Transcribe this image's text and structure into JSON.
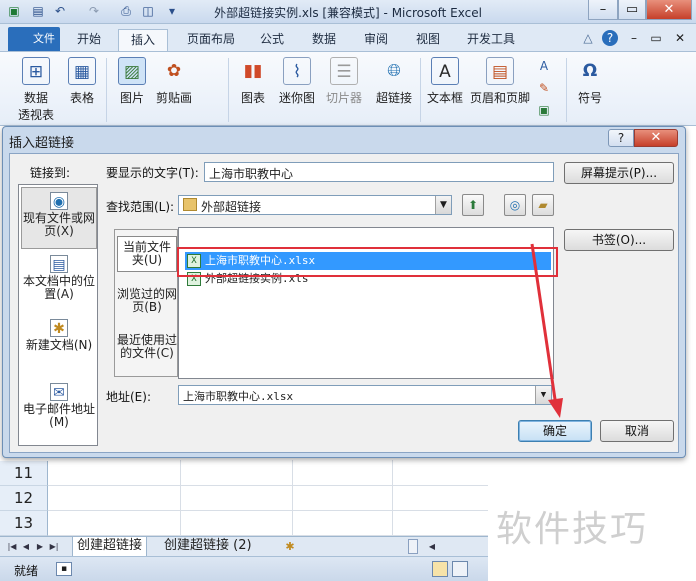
{
  "window": {
    "title": "外部超链接实例.xls  [兼容模式]  -  Microsoft Excel",
    "min_icon": "minimize-icon",
    "max_icon": "restore-icon",
    "close_icon": "close-icon"
  },
  "ribbon": {
    "tabs": [
      {
        "label": "文件"
      },
      {
        "label": "开始"
      },
      {
        "label": "插入"
      },
      {
        "label": "页面布局"
      },
      {
        "label": "公式"
      },
      {
        "label": "数据"
      },
      {
        "label": "审阅"
      },
      {
        "label": "视图"
      },
      {
        "label": "开发工具"
      }
    ],
    "active_tab": "插入",
    "buttons": [
      {
        "label": "数据",
        "sub": "透视表",
        "icon": "pivot-table-icon"
      },
      {
        "label": "表格",
        "icon": "table-icon"
      },
      {
        "label": "图片",
        "icon": "picture-icon"
      },
      {
        "label": "剪贴画",
        "icon": "clipart-icon"
      },
      {
        "label": "图表",
        "icon": "chart-icon"
      },
      {
        "label": "迷你图",
        "icon": "sparkline-icon"
      },
      {
        "label": "切片器",
        "icon": "slicer-icon"
      },
      {
        "label": "超链接",
        "icon": "hyperlink-globe-icon"
      },
      {
        "label": "文本框",
        "icon": "textbox-icon"
      },
      {
        "label": "页眉和页脚",
        "icon": "header-footer-icon"
      },
      {
        "label": "符号",
        "icon": "omega-symbol-icon"
      }
    ]
  },
  "sheet": {
    "rows": [
      "11",
      "12",
      "13"
    ],
    "tabs": [
      {
        "label": "创建超链接"
      },
      {
        "label": "创建超链接 (2)"
      }
    ],
    "status": "就绪"
  },
  "dialog": {
    "title": "插入超链接",
    "help": "?",
    "close": "✕",
    "link_to_label": "链接到:",
    "link_options": [
      {
        "label": "现有文件或网页(X)",
        "icon": "existing-file-globe-icon"
      },
      {
        "label": "本文档中的位置(A)",
        "icon": "place-in-document-icon"
      },
      {
        "label": "新建文档(N)",
        "icon": "new-document-icon"
      },
      {
        "label": "电子邮件地址(M)",
        "icon": "email-address-icon"
      }
    ],
    "display_text_label": "要显示的文字(T):",
    "display_text_value": "上海市职教中心",
    "screentip_button": "屏幕提示(P)...",
    "look_in_label": "查找范围(L):",
    "look_in_value": "外部超链接",
    "sub_tabs": [
      {
        "label": "当前文件夹(U)"
      },
      {
        "label": "浏览过的网页(B)"
      },
      {
        "label": "最近使用过的文件(C)"
      }
    ],
    "files": [
      {
        "name": "上海市职教中心.xlsx",
        "type": "xlsx"
      },
      {
        "name": "外部超链接实例.xls",
        "type": "xls"
      }
    ],
    "bookmark_button": "书签(O)...",
    "address_label": "地址(E):",
    "address_value": "上海市职教中心.xlsx",
    "ok_button": "确定",
    "cancel_button": "取消"
  },
  "watermark": "软件技巧",
  "colors": {
    "file_tab": "#2a6ebb",
    "selection": "#3399ff",
    "highlight_box": "#e0303a",
    "annotation_arrow": "#e0303a"
  }
}
